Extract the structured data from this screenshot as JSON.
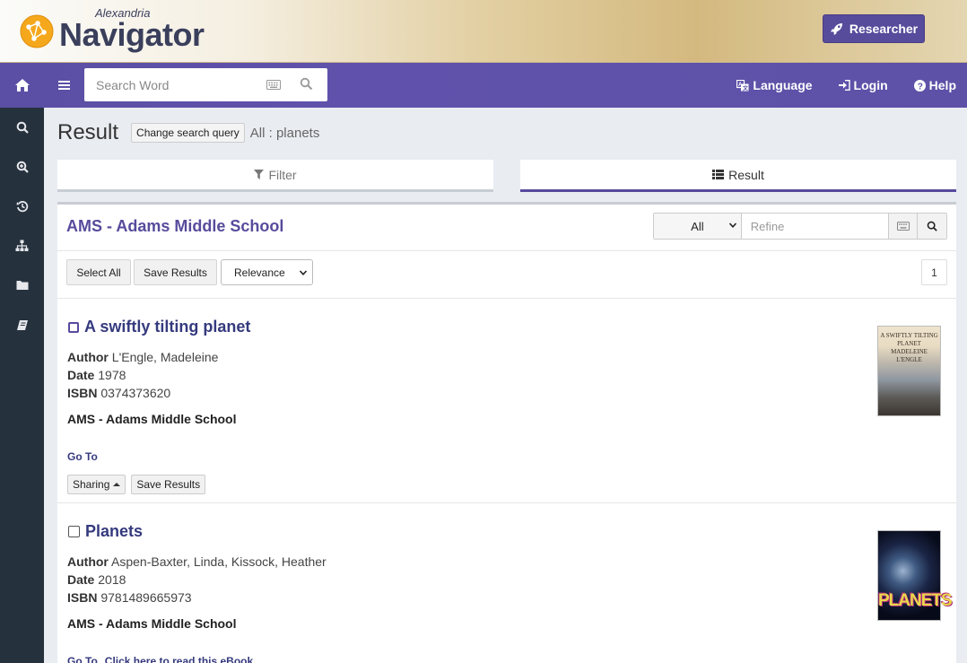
{
  "header": {
    "logo_small": "Alexandria",
    "logo_big": "Navigator",
    "researcher_label": "Researcher"
  },
  "sidebar": {
    "items": [
      {
        "icon": "home-icon"
      },
      {
        "icon": "search-icon"
      },
      {
        "icon": "zoom-in-icon"
      },
      {
        "icon": "history-icon"
      },
      {
        "icon": "sitemap-icon"
      },
      {
        "icon": "folder-icon"
      },
      {
        "icon": "book-icon"
      }
    ]
  },
  "topnav": {
    "search_placeholder": "Search Word",
    "language_label": "Language",
    "login_label": "Login",
    "help_label": "Help"
  },
  "main": {
    "title": "Result",
    "change_query_label": "Change search query",
    "query_text": "All : planets",
    "tabs": [
      {
        "label": "Filter",
        "active": false
      },
      {
        "label": "Result",
        "active": true
      }
    ],
    "school_title": "AMS - Adams Middle School",
    "scope_value": "All",
    "refine_placeholder": "Refine",
    "select_all_label": "Select All",
    "save_results_label": "Save Results",
    "sort_value": "Relevance",
    "page_number": "1"
  },
  "records": [
    {
      "title": "A swiftly tilting planet",
      "author_label": "Author",
      "author": "L'Engle, Madeleine",
      "date_label": "Date",
      "date": "1978",
      "isbn_label": "ISBN",
      "isbn": "0374373620",
      "location": "AMS - Adams Middle School",
      "goto_label": "Go To",
      "sharing_label": "Sharing",
      "save_label": "Save Results",
      "cover_text": "A SWIFTLY TILTING PLANET MADELEINE L'ENGLE"
    },
    {
      "title": "Planets",
      "author_label": "Author",
      "author": "Aspen-Baxter, Linda, Kissock, Heather",
      "date_label": "Date",
      "date": "2018",
      "isbn_label": "ISBN",
      "isbn": "9781489665973",
      "location": "AMS - Adams Middle School",
      "goto_label": "Go To",
      "ebook_label": "Click here to read this eBook",
      "cover_text": "PLANETS"
    }
  ],
  "colors": {
    "brand_purple": "#574b9c",
    "sidebar": "#26313e",
    "link_navy": "#353a7e"
  }
}
